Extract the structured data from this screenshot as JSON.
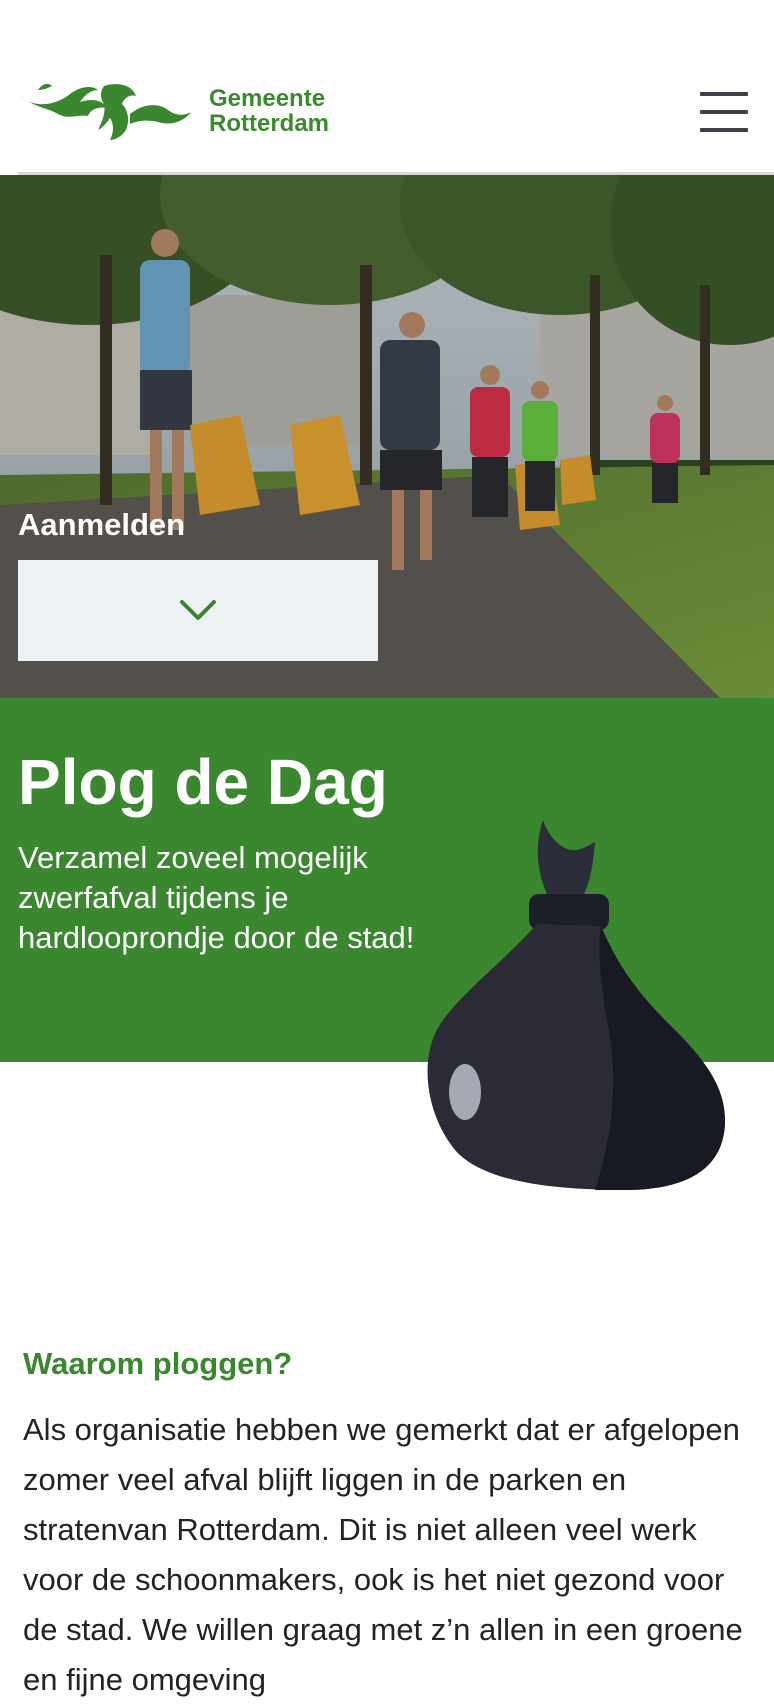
{
  "header": {
    "logo_line1": "Gemeente",
    "logo_line2": "Rotterdam",
    "menu_icon": "hamburger-icon"
  },
  "hero": {
    "image_alt": "Hardlopers die zwerfafval verzamelen in een park",
    "register_label": "Aanmelden",
    "dropdown_icon": "chevron-down-icon"
  },
  "intro": {
    "title": "Plog de Dag",
    "subtitle": "Verzamel zoveel mogelijk zwerfafval tijdens je hardlooprondje door de stad!",
    "illustration": "trash-bag-icon"
  },
  "why": {
    "heading": "Waarom ploggen?",
    "body": "Als organisatie hebben we gemerkt dat er afgelopen zomer veel afval blijft liggen in de parken en stratenvan Rotterdam. Dit is niet alleen veel werk voor de schoonmakers, ook is het niet gezond voor de stad. We willen graag met z’n allen in een groene en fijne omgeving"
  },
  "colors": {
    "brand_green": "#3a8730",
    "dark": "#2a2b35",
    "dropdown_bg": "#eef1f4"
  }
}
